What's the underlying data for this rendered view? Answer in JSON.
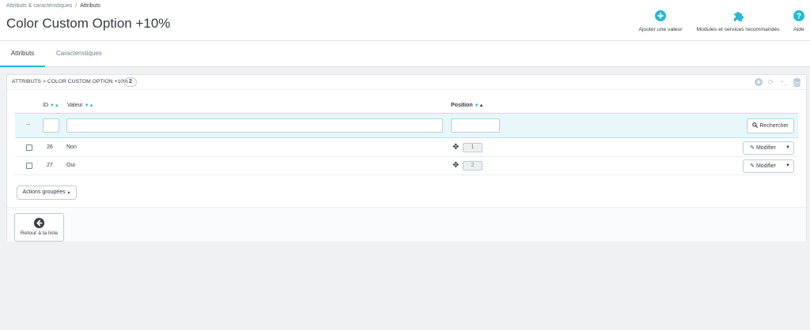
{
  "breadcrumb": {
    "parent": "Attributs & caractéristiques",
    "separator": "/",
    "current": "Attributs"
  },
  "page_title": "Color Custom Option +10%",
  "toolbar": [
    {
      "label": "Ajouter une valeur",
      "icon": "add-circle-icon"
    },
    {
      "label": "Modules et services recommandés",
      "icon": "puzzle-icon"
    },
    {
      "label": "Aide",
      "icon": "help-icon"
    }
  ],
  "tabs": [
    {
      "label": "Attributs",
      "active": true
    },
    {
      "label": "Caractéristiques",
      "active": false
    }
  ],
  "panel": {
    "title": "ATTRIBUTS > COLOR CUSTOM OPTION +10%",
    "count": "2",
    "tools": [
      "add-icon",
      "refresh-icon",
      "sql-terminal-icon",
      "database-icon"
    ]
  },
  "table": {
    "columns": {
      "id": "ID",
      "value": "Valeur",
      "position": "Position"
    },
    "filter_dash": "--",
    "search_label": "Rechercher",
    "rows": [
      {
        "id": "26",
        "value": "Non",
        "position": "1",
        "action": "Modifier"
      },
      {
        "id": "27",
        "value": "Oui",
        "position": "2",
        "action": "Modifier"
      }
    ],
    "bulk_actions": "Actions groupées"
  },
  "footer": {
    "back_label": "Retour à la liste"
  },
  "colors": {
    "accent": "#25b9d7",
    "text": "#363a41",
    "muted": "#6c868e",
    "filter_bg": "#eaf7fa"
  }
}
